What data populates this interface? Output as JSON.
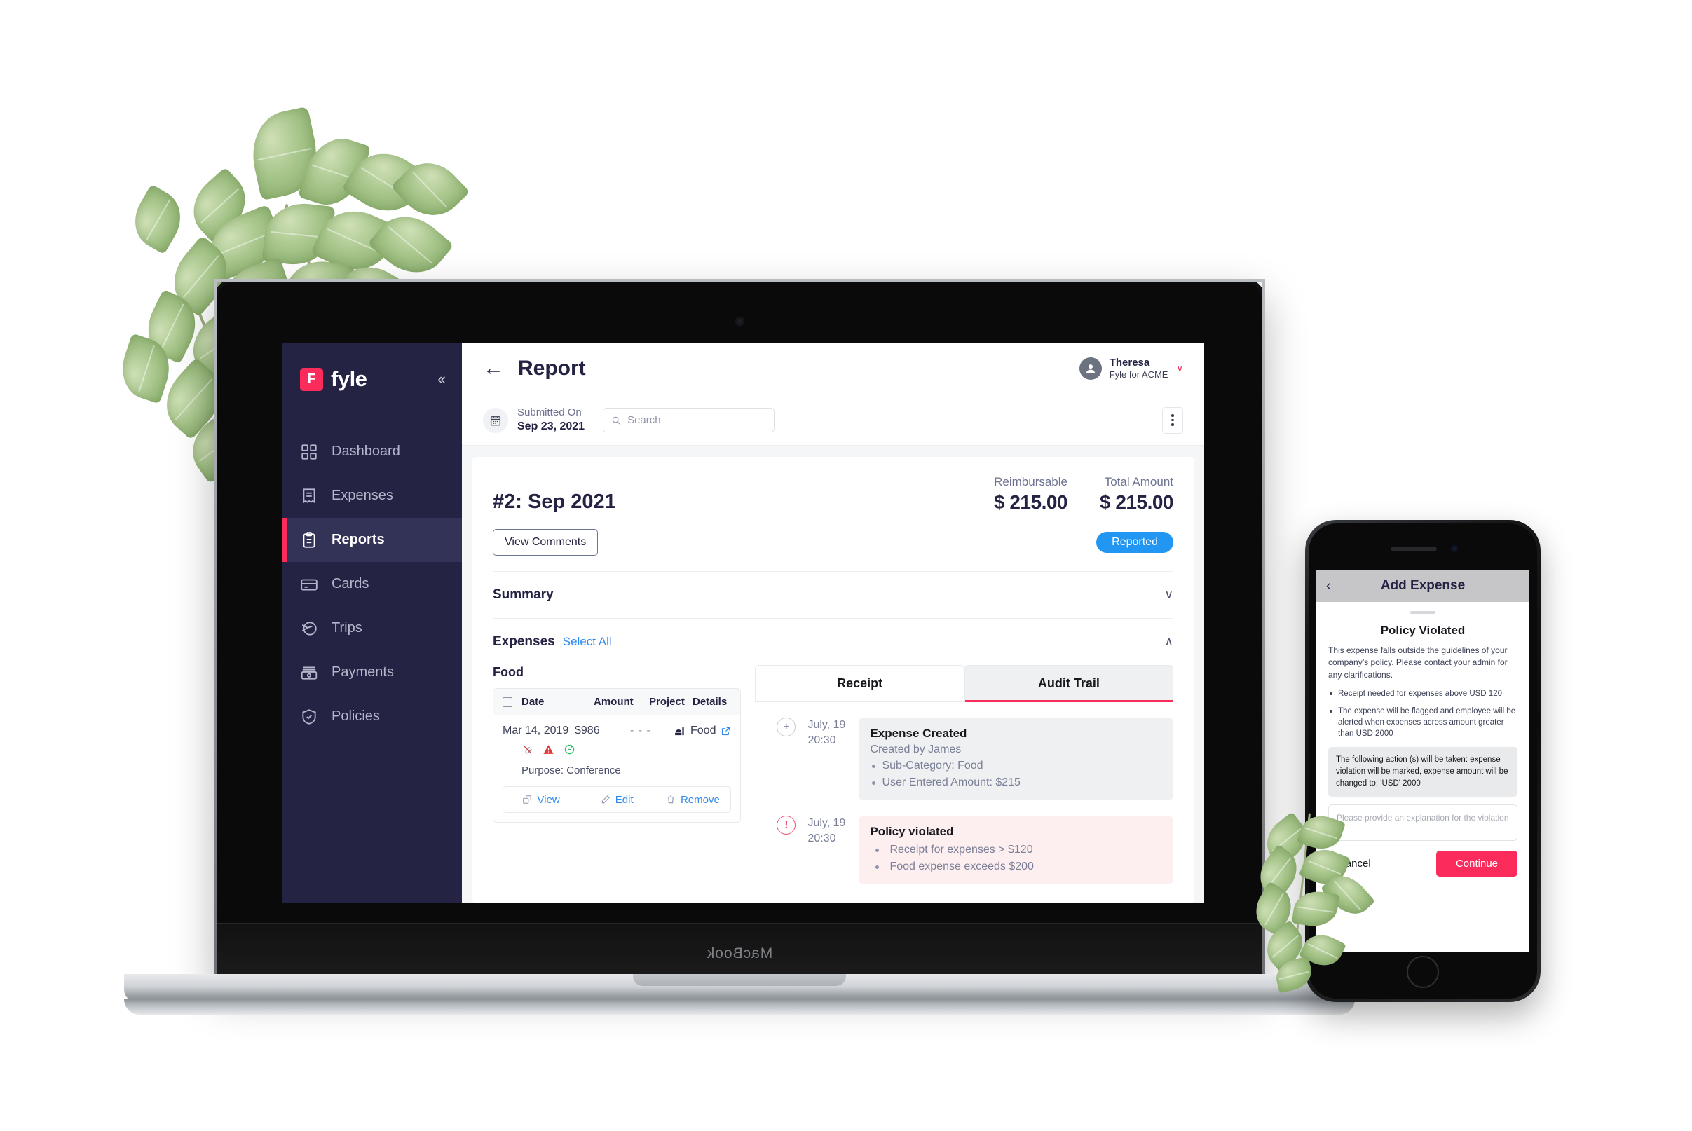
{
  "brand": {
    "name": "fyle",
    "mark_letter": "F",
    "collapse_icon": "chevrons-left-icon"
  },
  "sidebar": {
    "items": [
      {
        "label": "Dashboard",
        "icon": "grid-icon",
        "active": false
      },
      {
        "label": "Expenses",
        "icon": "receipt-icon",
        "active": false
      },
      {
        "label": "Reports",
        "icon": "clipboard-icon",
        "active": true
      },
      {
        "label": "Cards",
        "icon": "credit-card-icon",
        "active": false
      },
      {
        "label": "Trips",
        "icon": "plane-icon",
        "active": false
      },
      {
        "label": "Payments",
        "icon": "banknote-icon",
        "active": false
      },
      {
        "label": "Policies",
        "icon": "shield-check-icon",
        "active": false
      }
    ]
  },
  "topbar": {
    "back_icon": "arrow-left-icon",
    "title": "Report",
    "user_name": "Theresa",
    "user_org": "Fyle for ACME",
    "caret": "∨",
    "avatar_icon": "user-avatar-icon"
  },
  "subbar": {
    "calendar_icon": "calendar-icon",
    "submitted_label": "Submitted On",
    "submitted_value": "Sep 23, 2021",
    "search_placeholder": "Search",
    "search_value": "",
    "search_icon": "search-icon",
    "overflow_icon": "kebab-menu-icon"
  },
  "report": {
    "id_title": "#2: Sep 2021",
    "reimbursable_label": "Reimbursable",
    "reimbursable_value": "$ 215.00",
    "total_label": "Total Amount",
    "total_value": "$ 215.00",
    "view_comments_label": "View Comments",
    "status_badge": "Reported",
    "status_color": "#2196f3"
  },
  "sections": {
    "summary_label": "Summary",
    "summary_chevron": "chevron-down-icon",
    "expenses_label": "Expenses",
    "select_all_label": "Select All",
    "expenses_chevron": "chevron-up-icon"
  },
  "expenses": {
    "category_title": "Food",
    "columns": [
      "Date",
      "Amount",
      "Project",
      "Details"
    ],
    "rows": [
      {
        "date": "Mar 14, 2019",
        "amount": "$986",
        "project": "- - -",
        "details": "Food",
        "details_icon": "food-icon",
        "external_icon": "external-link-icon",
        "flags": [
          "no-attachment-icon",
          "policy-warning-icon",
          "recurring-icon"
        ],
        "purpose": "Purpose: Conference",
        "actions": [
          {
            "label": "View",
            "icon": "expand-icon"
          },
          {
            "label": "Edit",
            "icon": "pencil-icon"
          },
          {
            "label": "Remove",
            "icon": "trash-icon"
          }
        ]
      }
    ]
  },
  "detail_panel": {
    "tabs": [
      {
        "label": "Receipt",
        "active": false
      },
      {
        "label": "Audit Trail",
        "active": true
      }
    ],
    "accent_color": "#fb2b5b",
    "timeline": [
      {
        "icon": "plus-circle-icon",
        "date": "July, 19",
        "time": "20:30",
        "title": "Expense Created",
        "subtitle": "Created by James",
        "bullets": [
          "Sub-Category: Food",
          "User Entered Amount: $215"
        ],
        "kind": "info"
      },
      {
        "icon": "alert-circle-icon",
        "date": "July, 19",
        "time": "20:30",
        "title": "Policy violated",
        "subtitle": "",
        "bullets": [
          "Receipt for expenses > $120",
          "Food expense exceeds $200"
        ],
        "kind": "violation"
      }
    ]
  },
  "phone": {
    "back_icon": "chevron-left-icon",
    "nav_title": "Add Expense",
    "sheet_title": "Policy Violated",
    "paragraph": "This expense falls outside the guidelines of your company’s policy. Please contact your admin for any clarifications.",
    "bullets": [
      "Receipt needed for expenses above USD 120",
      "The expense will be flagged and employee will be alerted when expenses across amount greater than USD 2000"
    ],
    "note": "The following action (s) will be taken: expense violation will be marked, expense amount will be changed to: 'USD' 2000",
    "explanation_placeholder": "Please provide an explanation for the violation",
    "explanation_value": "",
    "cancel_label": "Cancel",
    "continue_label": "Continue",
    "continue_color": "#fb2b5b"
  },
  "hardware": {
    "laptop_word": "MacBook"
  }
}
